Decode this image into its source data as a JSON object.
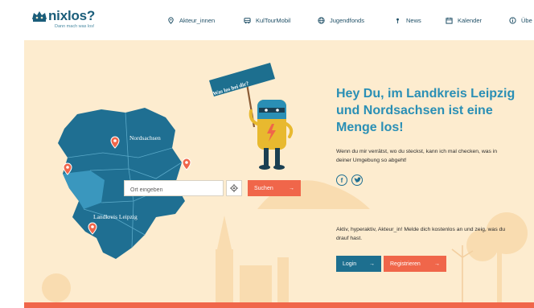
{
  "logo": {
    "name": "nixlos?",
    "tagline": "Dann mach was los!"
  },
  "nav": {
    "items": [
      {
        "label": "Akteur_innen",
        "icon": "map-pin-icon"
      },
      {
        "label": "KulTourMobil",
        "icon": "bus-icon"
      },
      {
        "label": "Jugendfonds",
        "icon": "globe-icon"
      },
      {
        "label": "News",
        "icon": "pin-icon"
      },
      {
        "label": "Kalender",
        "icon": "calendar-icon"
      },
      {
        "label": "Übe",
        "icon": "info-icon"
      }
    ]
  },
  "hero": {
    "headline": "Hey Du, im Landkreis Leipzig und Nordsachsen ist eine Menge los!",
    "intro": "Wenn du mir verrätst, wo du steckst, kann ich mal checken, was in deiner Umgebung so abgeht!",
    "sign_text": "Was los bei dir?",
    "social": {
      "facebook": "f",
      "twitter": "t"
    },
    "cta_text": "Aktiv, hyperaktiv, Akteur_in! Melde dich kostenlos an und zeig, was du drauf hast.",
    "login_label": "Login",
    "register_label": "Registrieren",
    "arrow": "→"
  },
  "map": {
    "region_north": "Nordsachsen",
    "region_south": "Landkreis Leipzig"
  },
  "search": {
    "placeholder": "Ort eingeben",
    "button_label": "Suchen"
  },
  "colors": {
    "accent": "#f0664a",
    "primary": "#1d6f8f",
    "map": "#1f6f92",
    "background": "#fdeccf"
  }
}
